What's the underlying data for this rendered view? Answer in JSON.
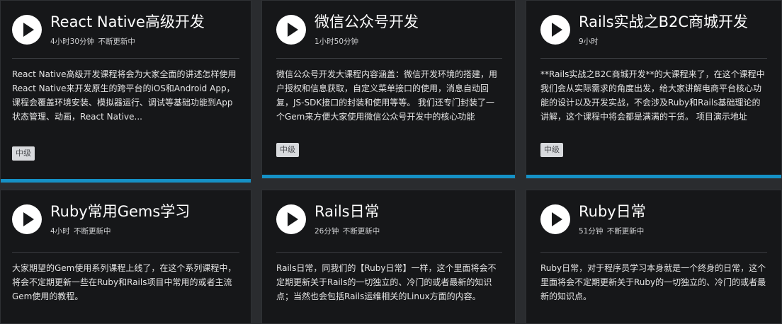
{
  "courses": [
    {
      "title": "React Native高级开发",
      "duration": "4小时30分钟",
      "update": "不断更新中",
      "description": "React Native高级开发课程将会为大家全面的讲述怎样使用React Native来开发原生的跨平台的iOS和Android App，课程会覆盖环境安装、模拟器运行、调试等基础功能到App状态管理、动画，React Native...",
      "level": "中级"
    },
    {
      "title": "微信公众号开发",
      "duration": "1小时50分钟",
      "update": "",
      "description": "微信公众号开发大课程内容涵盖：微信开发环境的搭建，用户授权和信息获取，自定义菜单接口的使用，消息自动回复，JS-SDK接口的封装和使用等等。 我们还专门封装了一个Gem来方便大家使用微信公众号开发中的核心功能",
      "level": "中级"
    },
    {
      "title": "Rails实战之B2C商城开发",
      "duration": "9小时",
      "update": "",
      "description": "**Rails实战之B2C商城开发**的大课程来了，在这个课程中我们会从实际需求的角度出发，给大家讲解电商平台核心功能的设计以及开发实战，不会涉及Ruby和Rails基础理论的讲解，这个课程中将会都是满满的干货。 项目演示地址",
      "level": "中级"
    },
    {
      "title": "Ruby常用Gems学习",
      "duration": "4小时",
      "update": "不断更新中",
      "description": "大家期望的Gem使用系列课程上线了，在这个系列课程中，将会不定期更新一些在Ruby和Rails项目中常用的或者主流Gem使用的教程。",
      "level": ""
    },
    {
      "title": "Rails日常",
      "duration": "26分钟",
      "update": "不断更新中",
      "description": "Rails日常，同我们的【Ruby日常】一样，这个里面将会不定期更新关于Rails的一切独立的、冷门的或者最新的知识点；当然也会包括Rails运维相关的Linux方面的内容。",
      "level": ""
    },
    {
      "title": "Ruby日常",
      "duration": "51分钟",
      "update": "不断更新中",
      "description": "Ruby日常，对于程序员学习本身就是一个终身的日常，这个里面将会不定期更新关于Ruby的一切独立的、冷门的或者最新的知识点。",
      "level": ""
    }
  ]
}
